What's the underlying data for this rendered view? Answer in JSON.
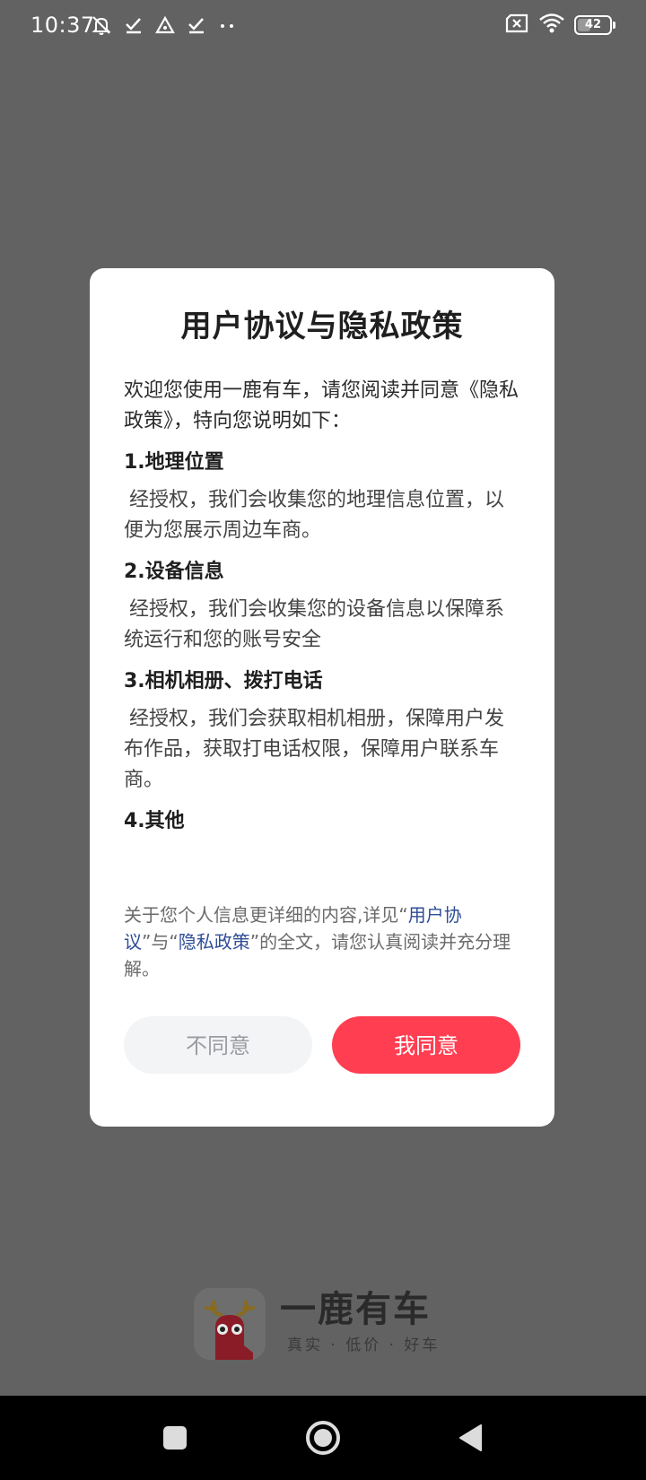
{
  "status_bar": {
    "time": "10:37",
    "battery_level": "42",
    "battery_fraction": 0.42,
    "left_icons": [
      "mute-bell-icon",
      "check-icon",
      "alert-triangle-icon",
      "check-icon",
      "more-dots-icon"
    ],
    "right_icons": [
      "sim-disabled-icon",
      "wifi-icon",
      "battery-icon"
    ]
  },
  "dialog": {
    "title": "用户协议与隐私政策",
    "intro": "欢迎您使用一鹿有车，请您阅读并同意《隐私政策》，特向您说明如下：",
    "sections": [
      {
        "title": "1.地理位置",
        "text": "经授权，我们会收集您的地理信息位置，以便为您展示周边车商。"
      },
      {
        "title": "2.设备信息",
        "text": "经授权，我们会收集您的设备信息以保障系统运行和您的账号安全"
      },
      {
        "title": "3.相机相册、拨打电话",
        "text": "经授权，我们会获取相机相册，保障用户发布作品，获取打电话权限，保障用户联系车商。"
      },
      {
        "title": "4.其他",
        "text": ""
      }
    ],
    "footer": {
      "prefix": "关于您个人信息更详细的内容,详见“",
      "link_user_agreement": "用户协议",
      "middle": "”与“",
      "link_privacy_policy": "隐私政策",
      "suffix": "”的全文，请您认真阅读并充分理解。"
    },
    "disagree_label": "不同意",
    "agree_label": "我同意"
  },
  "splash": {
    "brand_name": "一鹿有车",
    "slogan": "真实 · 低价 · 好车",
    "logo_icon": "deer-logo-icon"
  },
  "nav_bar": {
    "icons": [
      "recent-apps-icon",
      "home-icon",
      "back-icon"
    ]
  },
  "colors": {
    "overlay": "#626262",
    "agree_button": "#ff3e52",
    "disagree_button": "#f3f4f6",
    "link": "#2f4d98"
  }
}
